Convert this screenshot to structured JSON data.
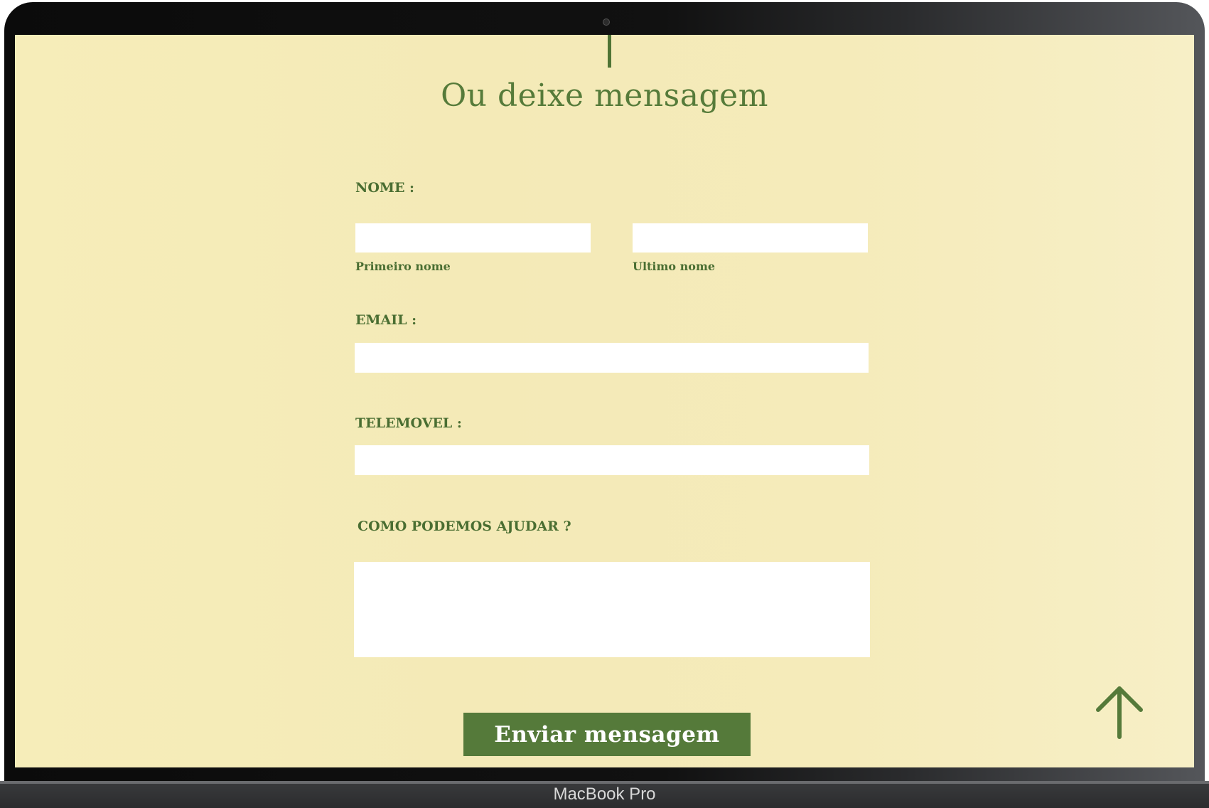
{
  "device": {
    "brand_label": "MacBook Pro"
  },
  "form": {
    "heading": "Ou deixe mensagem",
    "name": {
      "label": "NOME :",
      "first_name_caption": "Primeiro nome",
      "last_name_caption": "Ultimo nome",
      "first_name_value": "",
      "last_name_value": ""
    },
    "email": {
      "label": "EMAIL :",
      "value": ""
    },
    "phone": {
      "label": "TELEMOVEL :",
      "value": ""
    },
    "message": {
      "label": "COMO PODEMOS AJUDAR ?",
      "value": ""
    },
    "submit_label": "Enviar mensagem"
  },
  "scroll_top": {
    "icon": "arrow-up-icon"
  },
  "colors": {
    "background": "#f5ebb9",
    "accent_green": "#557a3a",
    "field": "#ffffff",
    "text_green": "#4a6e32"
  }
}
